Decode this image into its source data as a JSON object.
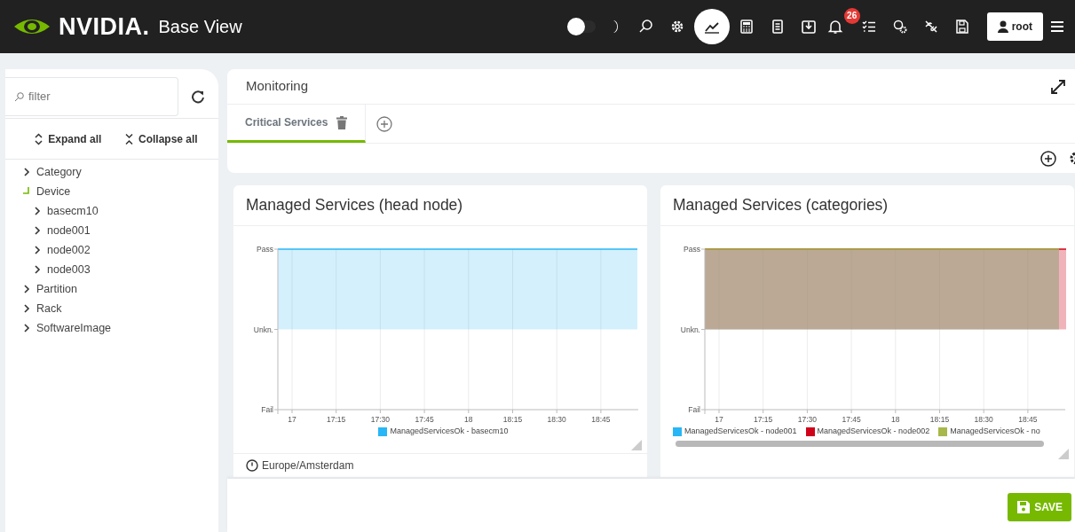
{
  "navbar": {
    "brand": "NVIDIA.",
    "title": "Base View",
    "toolbar": [
      {
        "on": false
      },
      {
        "selected": false
      },
      {
        "selected": false
      },
      {
        "selected": false
      },
      {
        "selected": true
      },
      {
        "selected": false
      },
      {
        "selected": false
      },
      {
        "selected": false
      },
      {
        "selected": false,
        "badge": "26"
      },
      {
        "selected": false
      },
      {
        "selected": false
      },
      {
        "selected": false
      },
      {
        "selected": false
      }
    ],
    "user": "root"
  },
  "sidebar": {
    "filter": {
      "placeholder": "filter"
    },
    "expand_all": "Expand all",
    "collapse_all": "Collapse all",
    "tree": [
      {
        "label": "Category",
        "expanded": false
      },
      {
        "label": "Device",
        "expanded": true,
        "children": [
          {
            "label": "basecm10",
            "expanded": false
          },
          {
            "label": "node001",
            "expanded": false
          },
          {
            "label": "node002",
            "expanded": false
          },
          {
            "label": "node003",
            "expanded": false
          }
        ]
      },
      {
        "label": "Partition",
        "expanded": false
      },
      {
        "label": "Rack",
        "expanded": false
      },
      {
        "label": "SoftwareImage",
        "expanded": false
      }
    ]
  },
  "monitoring": {
    "title": "Monitoring",
    "tabs": [
      {
        "label": "Critical Services",
        "selected": true
      }
    ]
  },
  "panels": [
    {
      "title": "Managed Services (head node)",
      "chart": {
        "y_labels": [
          "Pass",
          "Unkn.",
          "Fail"
        ],
        "x_labels": [
          "17",
          "17:15",
          "17:30",
          "17:45",
          "18",
          "18:15",
          "18:30",
          "18:45"
        ],
        "series": [
          {
            "name": "ManagedServicesOk - basecm10",
            "color": "#29b6f6"
          }
        ]
      },
      "timezone": "Europe/Amsterdam"
    },
    {
      "title": "Managed Services (categories)",
      "chart": {
        "y_labels": [
          "Pass",
          "Unkn.",
          "Fail"
        ],
        "x_labels": [
          "17",
          "17:15",
          "17:30",
          "17:45",
          "18",
          "18:15",
          "18:30",
          "18:45"
        ],
        "series": [
          {
            "name": "ManagedServicesOk - node001",
            "color": "#29b6f6"
          },
          {
            "name": "ManagedServicesOk - node002",
            "color": "#d0021b"
          },
          {
            "name": "ManagedServicesOk - no",
            "color": "#a8b84a"
          }
        ]
      }
    }
  ],
  "save_button": "SAVE"
}
